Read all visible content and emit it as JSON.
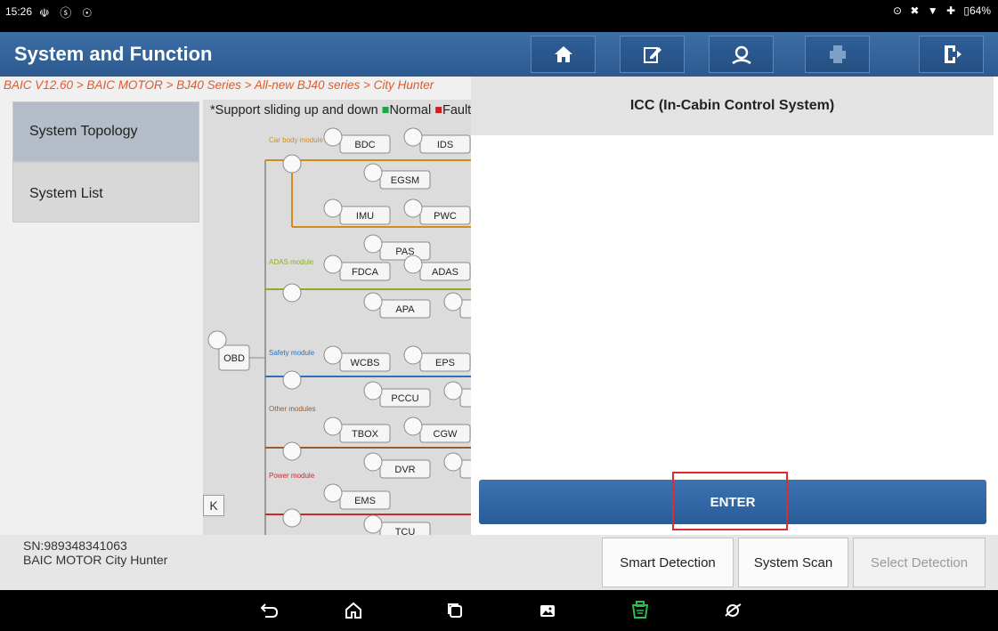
{
  "status_bar": {
    "time": "15:26",
    "left_icons": "☫ ⓢ ☉",
    "right_icons": "⊙ ✖ ▼ ✚",
    "battery": "64%"
  },
  "header": {
    "title": "System and Function",
    "buttons": [
      "home-icon",
      "edit-report-icon",
      "support-icon",
      "print-icon",
      "exit-icon"
    ]
  },
  "breadcrumb": "BAIC V12.60 > BAIC MOTOR > BJ40 Series > All-new BJ40 series > City Hunter",
  "sidebar": {
    "items": [
      {
        "label": "System Topology",
        "selected": true
      },
      {
        "label": "System List",
        "selected": false
      }
    ],
    "collapse_label": "K"
  },
  "topology": {
    "note": "*Support sliding up and down",
    "legend": [
      {
        "label": "Normal",
        "color": "#21a34a"
      },
      {
        "label": "Fault",
        "color": "#d11d1d"
      }
    ],
    "gateway": "OBD",
    "groups": [
      {
        "label": "Car body module",
        "color": "#d58b1c",
        "row1": [
          "BDC",
          "IDS"
        ],
        "row2": [
          "EGSM"
        ],
        "row3": [
          "IMU",
          "PWC"
        ],
        "row4": [
          "PAS",
          "S"
        ]
      },
      {
        "label": "ADAS module",
        "color": "#8cad2a",
        "row1": [
          "FDCA",
          "ADAS"
        ],
        "row2": [
          "APA",
          "CM"
        ]
      },
      {
        "label": "Safety module",
        "color": "#2f6fb8",
        "row1": [
          "WCBS",
          "EPS"
        ],
        "row2": [
          "PCCU",
          "S"
        ]
      },
      {
        "label": "Other modules",
        "color": "#9a5a30",
        "row1": [
          "TBOX",
          "CGW"
        ],
        "row2": [
          "DVR",
          "A"
        ]
      },
      {
        "label": "Power module",
        "color": "#c82a2a",
        "row1": [
          "EMS"
        ],
        "row2": [
          "TCU"
        ]
      }
    ]
  },
  "right_panel": {
    "title": "ICC (In-Cabin Control System)",
    "enter_label": "ENTER"
  },
  "footer": {
    "sn": "SN:989348341063",
    "vehicle": "BAIC MOTOR City Hunter",
    "buttons": [
      {
        "label": "Smart Detection",
        "enabled": true
      },
      {
        "label": "System Scan",
        "enabled": true
      },
      {
        "label": "Select Detection",
        "enabled": false
      }
    ]
  },
  "nav": [
    "back-icon",
    "home-icon",
    "recents-icon",
    "gallery-icon",
    "vci-icon",
    "browser-icon"
  ]
}
